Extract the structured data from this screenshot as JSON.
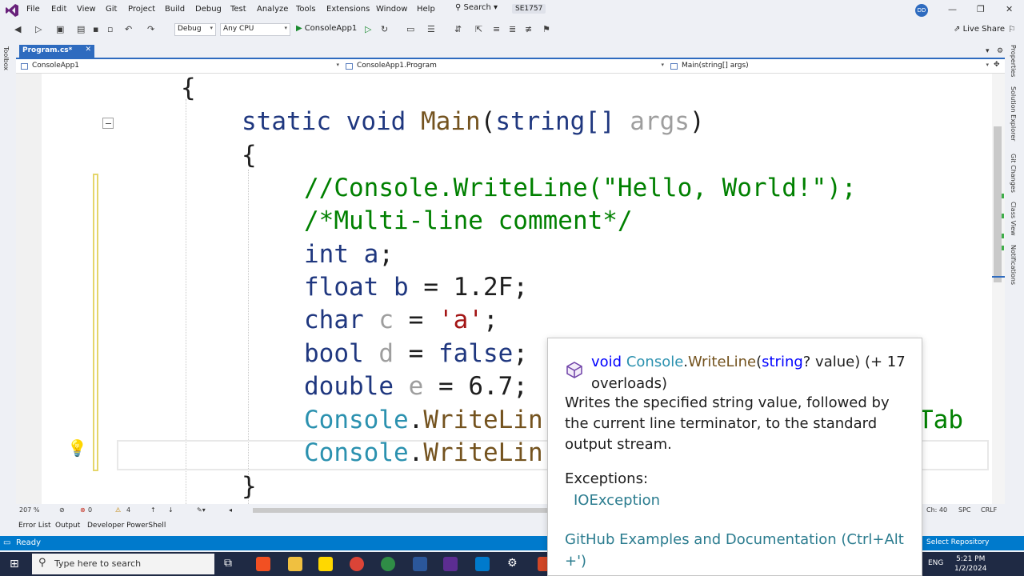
{
  "menubar": {
    "items": [
      "File",
      "Edit",
      "View",
      "Git",
      "Project",
      "Build",
      "Debug",
      "Test",
      "Analyze",
      "Tools",
      "Extensions",
      "Window",
      "Help"
    ],
    "search_label": "Search",
    "solution_name": "SE1757",
    "user_initials": "DD"
  },
  "toolbar": {
    "config": "Debug",
    "platform": "Any CPU",
    "start_label": "ConsoleApp1",
    "live_share": "Live Share"
  },
  "side": {
    "toolbox": "Toolbox",
    "right_panels": [
      "Properties",
      "Solution Explorer",
      "Git Changes",
      "Class View",
      "Notifications"
    ]
  },
  "tab": {
    "title": "Program.cs*"
  },
  "navbar": {
    "project": "ConsoleApp1",
    "type": "ConsoleApp1.Program",
    "member": "Main(string[] args)"
  },
  "code": {
    "open_brace_class": "{",
    "main_sig": {
      "kw1": "static",
      "kw2": "void",
      "name": "Main",
      "paren_open": "(",
      "type": "string[]",
      "param": "args",
      "paren_close": ")"
    },
    "open_brace_method": "{",
    "comment1": "//Console.WriteLine(\"Hello, World!\");",
    "comment2": "/*Multi-line comment*/",
    "l_int": {
      "kw": "int",
      "var": "a",
      "rest": ";"
    },
    "l_float": {
      "kw": "float",
      "var": "b",
      "rest": " = 1.2F;"
    },
    "l_char": {
      "kw": "char",
      "var": "c",
      "eq": " = ",
      "val": "'a'",
      "end": ";"
    },
    "l_bool": {
      "kw": "bool",
      "var": "d",
      "eq": " = ",
      "val": "false",
      "end": ";"
    },
    "l_double": {
      "kw": "double",
      "var": "e",
      "rest": " = 6.7;"
    },
    "l_console1": {
      "cls": "Console",
      "dot": ".",
      "method": "WriteLin",
      "tail": "Tab"
    },
    "l_console2": {
      "cls": "Console",
      "dot": ".",
      "method": "WriteLin"
    },
    "close_brace_method": "}"
  },
  "tooltip": {
    "sig_void": "void ",
    "sig_class": "Console",
    "sig_dot": ".",
    "sig_method": "WriteLine",
    "sig_paren": "(",
    "sig_type": "string",
    "sig_rest": "? value) (+ 17 overloads)",
    "description": "Writes the specified string value, followed by the current line terminator, to the standard output stream.",
    "exceptions_label": "Exceptions:",
    "exception_item": "IOException",
    "link": "GitHub Examples and Documentation (Ctrl+Alt +')"
  },
  "editor_status": {
    "zoom": "207 %",
    "errors": "0",
    "warnings": "4",
    "col": "Ch: 40",
    "spc": "SPC",
    "eol": "CRLF"
  },
  "bottom_tabs": [
    "Error List",
    "Output",
    "Developer PowerShell"
  ],
  "statusbar": {
    "ready": "Ready",
    "repo": "Select Repository"
  },
  "taskbar": {
    "search_placeholder": "Type here to search",
    "lang": "ENG",
    "time": "5:21 PM",
    "date": "1/2/2024"
  },
  "colors": {
    "accent": "#007acc",
    "keyword": "#0000ff",
    "comment": "#008000",
    "string": "#a31515",
    "class": "#2b91af",
    "method": "#74531f"
  }
}
